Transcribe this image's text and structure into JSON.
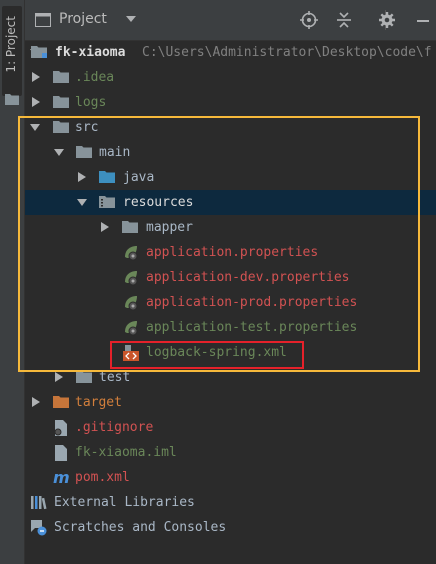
{
  "side_tab": {
    "label": "1: Project"
  },
  "header": {
    "title": "Project"
  },
  "tree": {
    "root": {
      "name": "fk-xiaoma",
      "path": "C:\\Users\\Administrator\\Desktop\\code\\f"
    },
    "idea": "idea",
    "logs": "logs",
    "src": "src",
    "main": "main",
    "java": "java",
    "resources": "resources",
    "mapper": "mapper",
    "app_props": "application.properties",
    "app_dev_props": "application-dev.properties",
    "app_prod_props": "application-prod.properties",
    "app_test_props": "application-test.properties",
    "logback": "logback-spring.xml",
    "test": "test",
    "target": "target",
    "gitignore": ".gitignore",
    "iml": "fk-xiaoma.iml",
    "pom": "pom.xml",
    "external_libraries": "External Libraries",
    "scratches": "Scratches and Consoles"
  },
  "colors": {
    "background": "#2b2b2b",
    "selection": "#0d293e",
    "highlight_yellow": "#f6b93b",
    "highlight_red": "#e5212a",
    "excluded": "#d27f3c",
    "ignored": "#6a8759",
    "unversioned": "#d25252"
  },
  "icons": [
    "project-icon",
    "locate-icon",
    "collapse-icon",
    "gear-icon",
    "minimize-icon",
    "folder-icon",
    "module-icon",
    "spring-leaf-icon",
    "xml-icon",
    "maven-icon",
    "library-icon",
    "scratches-icon"
  ]
}
